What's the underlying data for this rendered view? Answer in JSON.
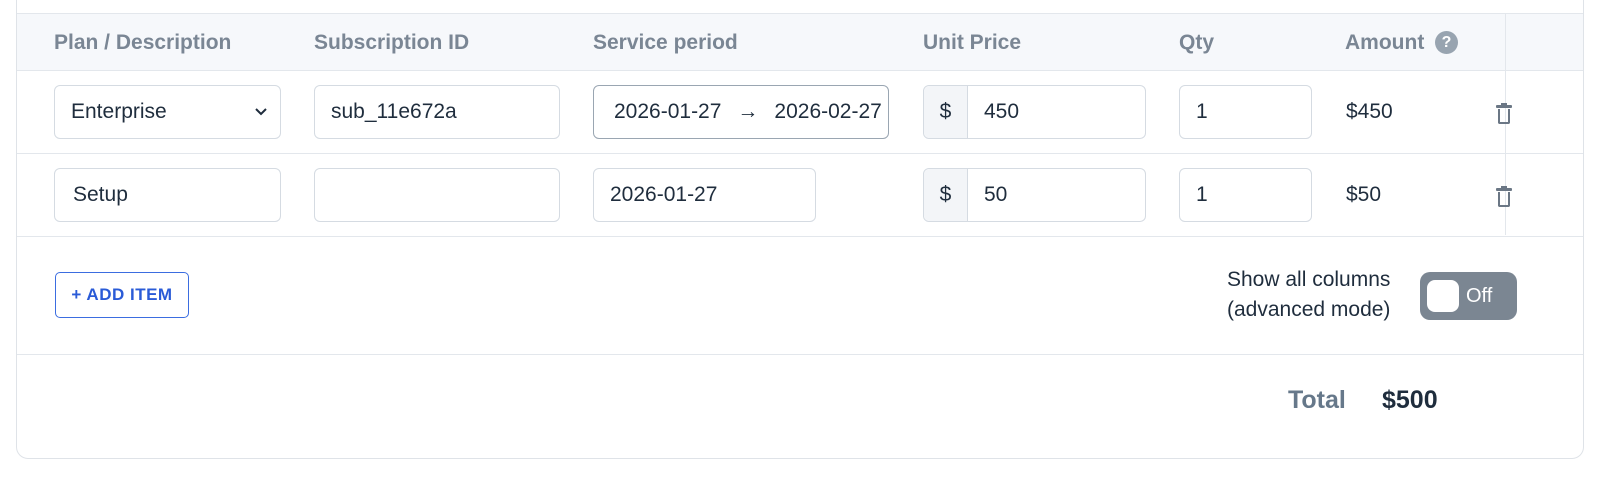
{
  "table": {
    "headers": {
      "plan": "Plan / Description",
      "subscription_id": "Subscription ID",
      "service_period": "Service period",
      "unit_price": "Unit Price",
      "qty": "Qty",
      "amount": "Amount"
    },
    "help_icon": "question-circle-icon",
    "rows": [
      {
        "plan": "Enterprise",
        "plan_type": "select",
        "subscription_id": "sub_11e672a",
        "period_start": "2026-01-27",
        "period_arrow": "→",
        "period_end": "2026-02-27",
        "currency": "$",
        "unit_price": "450",
        "qty": "1",
        "amount": "$450"
      },
      {
        "plan": "Setup",
        "plan_type": "text",
        "subscription_id": "",
        "period_date": "2026-01-27",
        "currency": "$",
        "unit_price": "50",
        "qty": "1",
        "amount": "$50"
      }
    ]
  },
  "actions": {
    "add_item_label": "+ ADD ITEM",
    "toggle_label_line1": "Show all columns",
    "toggle_label_line2": "(advanced mode)",
    "toggle_state": "Off"
  },
  "totals": {
    "label": "Total",
    "value": "$500"
  },
  "colors": {
    "accent": "#2a5bd7",
    "toggle_off": "#7b8692",
    "header_bg": "#f6f8fb"
  }
}
